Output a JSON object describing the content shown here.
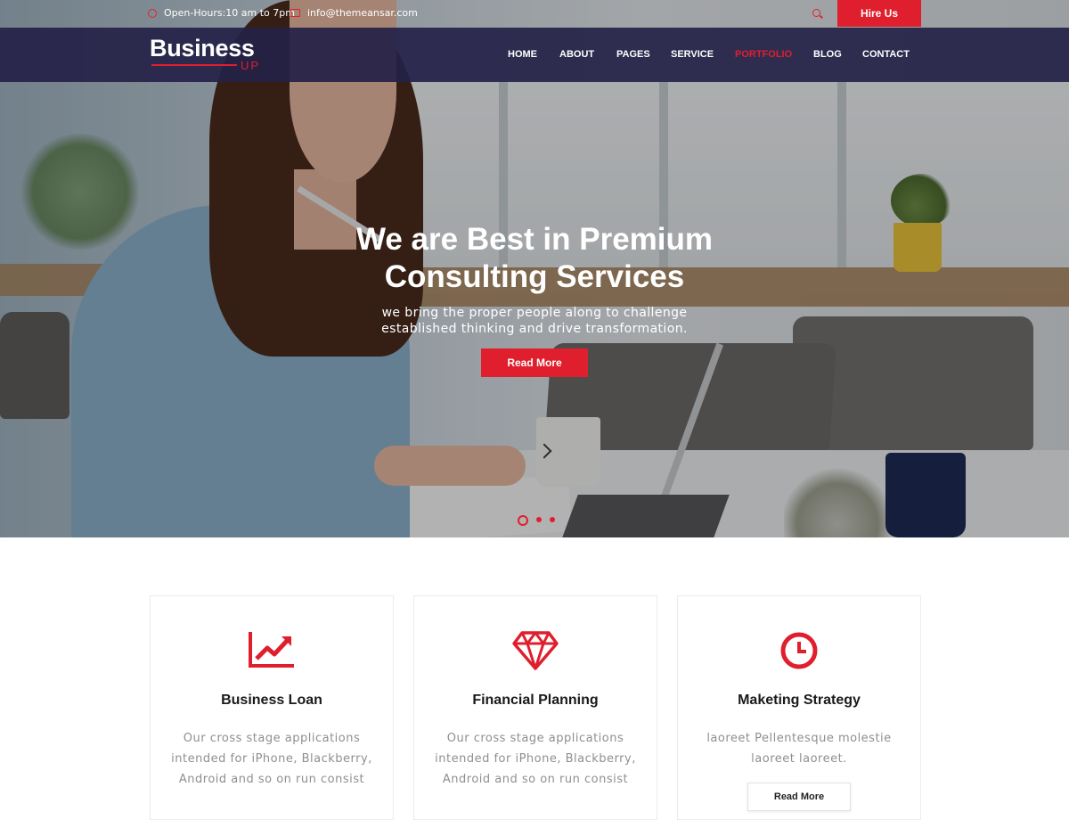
{
  "topbar": {
    "hours": "Open-Hours:10 am to 7pm",
    "email": "info@themeansar.com",
    "hire_label": "Hire Us"
  },
  "brand": {
    "name": "Business",
    "suffix": "UP"
  },
  "nav": {
    "items": [
      "HOME",
      "ABOUT",
      "PAGES",
      "SERVICE",
      "PORTFOLIO",
      "BLOG",
      "CONTACT"
    ],
    "active": "PORTFOLIO"
  },
  "hero": {
    "title_line1": "We are Best in Premium",
    "title_line2": "Consulting Services",
    "subtitle_line1": "we bring the proper people along to challenge",
    "subtitle_line2": "established thinking and drive transformation.",
    "button_label": "Read More",
    "slides": 3,
    "active_slide": 1
  },
  "services": [
    {
      "icon": "trending-up-icon",
      "title": "Business Loan",
      "text": "Our cross stage applications intended for iPhone, Blackberry, Android and so on run consist"
    },
    {
      "icon": "diamond-icon",
      "title": "Financial Planning",
      "text": "Our cross stage applications intended for iPhone, Blackberry, Android and so on run consist"
    },
    {
      "icon": "clock-icon",
      "title": "Maketing Strategy",
      "text": "laoreet Pellentesque molestie laoreet laoreet.",
      "button_label": "Read More"
    }
  ],
  "colors": {
    "accent": "#df1f2d",
    "navbar": "#242248"
  }
}
